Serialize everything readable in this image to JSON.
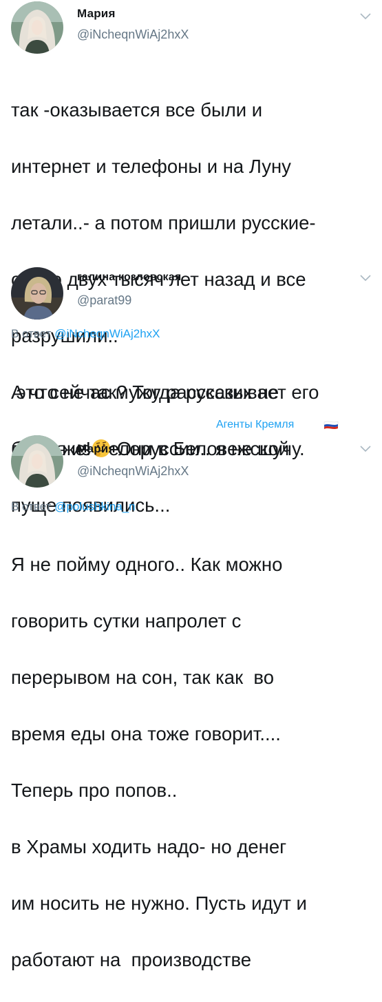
{
  "tweets": [
    {
      "name": "Мария",
      "handle": "@iNcheqnWiAj2hxX",
      "avatar_icon": "woman-portrait-avatar",
      "menu_icon": "chevron-down-icon",
      "lines": [
        "так -оказывается все были и",
        "интернет и телефоны и на Луну",
        "летали..-  а потом пришли русские-",
        "около двух тысяч лет назад и все",
        "разрушили..",
        " это сейчас мужу рассказывает его",
        "гостья из Белоруссии.. я не шучу."
      ]
    },
    {
      "name": "галина козловская",
      "handle": "@parat99",
      "avatar_icon": "woman-portrait-avatar",
      "menu_icon": "chevron-down-icon",
      "reply_prefix": "В ответ",
      "reply_to": "@iNcheqnWiAj2hxX",
      "lines_before_emoji": [
        "А что не так? Тогда русских не",
        "было же!"
      ],
      "emoji": "thinking-face-emoji",
      "line_after_emoji": " Они в Беловежской",
      "last_line": "пуще появились...",
      "tag": "Агенты Кремля",
      "flag_icon": "russia-flag-icon"
    },
    {
      "name": "Мария",
      "handle": "@iNcheqnWiAj2hxX",
      "avatar_icon": "woman-portrait-avatar",
      "menu_icon": "chevron-down-icon",
      "reply_prefix": "В ответ",
      "reply_to": "@polushkina_n",
      "lines": [
        "Я не пойму одного.. Как можно",
        "говорить сутки напролет с",
        "перерывом на сон, так как  во",
        "время еды она тоже говорит....",
        "Теперь про попов..",
        "в Храмы ходить надо- но денег",
        "им носить не нужно. Пусть идут и",
        "работают на  производстве"
      ]
    }
  ],
  "colors": {
    "text": "#14171a",
    "secondary": "#657786",
    "link": "#1da1f2"
  }
}
